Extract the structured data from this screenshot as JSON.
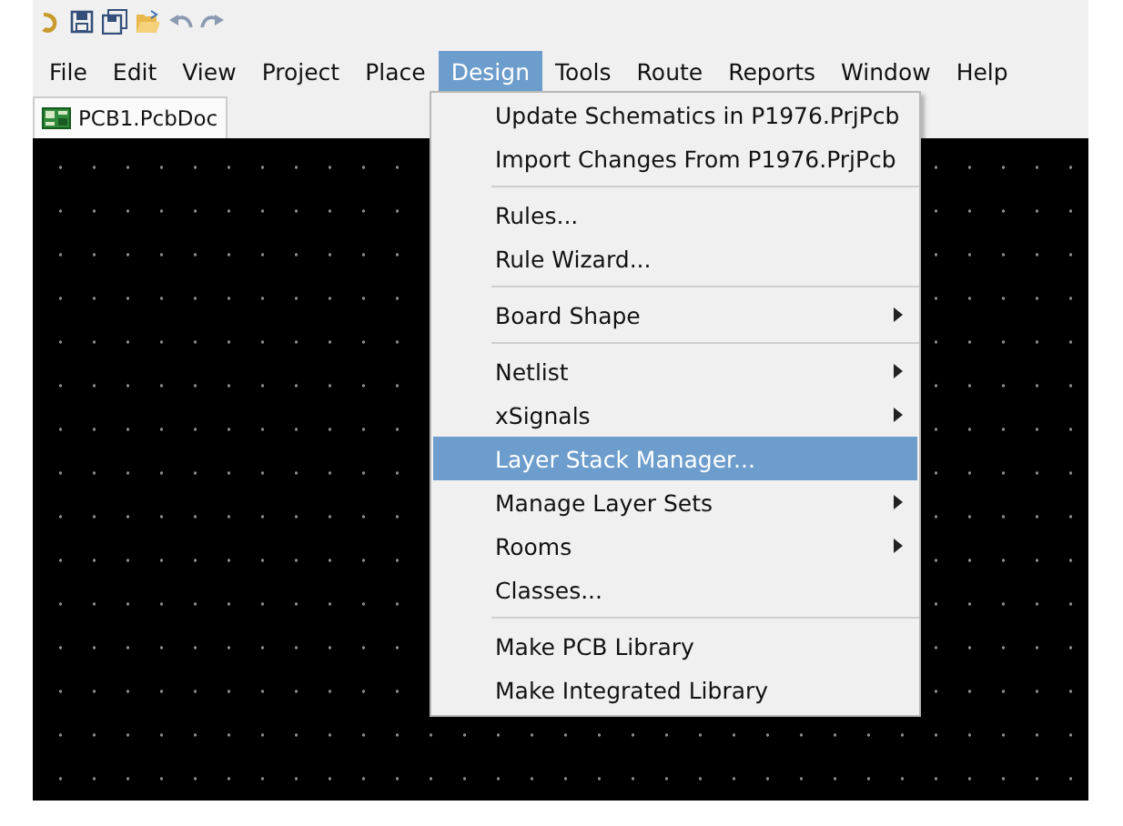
{
  "toolbar": [
    {
      "kind": "logo"
    },
    {
      "kind": "save"
    },
    {
      "kind": "save-all"
    },
    {
      "kind": "open"
    },
    {
      "kind": "undo"
    },
    {
      "kind": "redo"
    }
  ],
  "menubar": [
    {
      "label": "File",
      "selected": false
    },
    {
      "label": "Edit",
      "selected": false
    },
    {
      "label": "View",
      "selected": false
    },
    {
      "label": "Project",
      "selected": false
    },
    {
      "label": "Place",
      "selected": false
    },
    {
      "label": "Design",
      "selected": true
    },
    {
      "label": "Tools",
      "selected": false
    },
    {
      "label": "Route",
      "selected": false
    },
    {
      "label": "Reports",
      "selected": false
    },
    {
      "label": "Window",
      "selected": false
    },
    {
      "label": "Help",
      "selected": false
    }
  ],
  "tabs": [
    {
      "label": "PCB1.PcbDoc",
      "selected": true
    }
  ],
  "menu": {
    "items": [
      {
        "kind": "command",
        "label": "Update Schematics in P1976.PrjPcb",
        "selected": false
      },
      {
        "kind": "command",
        "label": "Import Changes From P1976.PrjPcb",
        "selected": false
      },
      {
        "kind": "separator"
      },
      {
        "kind": "command",
        "label": "Rules...",
        "selected": false
      },
      {
        "kind": "command",
        "label": "Rule Wizard...",
        "selected": false
      },
      {
        "kind": "separator"
      },
      {
        "kind": "submenu",
        "label": "Board Shape",
        "selected": false
      },
      {
        "kind": "separator"
      },
      {
        "kind": "submenu",
        "label": "Netlist",
        "selected": false
      },
      {
        "kind": "submenu",
        "label": "xSignals",
        "selected": false
      },
      {
        "kind": "command",
        "label": "Layer Stack Manager...",
        "selected": true
      },
      {
        "kind": "submenu",
        "label": "Manage Layer Sets",
        "selected": false
      },
      {
        "kind": "submenu",
        "label": "Rooms",
        "selected": false
      },
      {
        "kind": "command",
        "label": "Classes...",
        "selected": false
      },
      {
        "kind": "separator"
      },
      {
        "kind": "command",
        "label": "Make PCB Library",
        "selected": false
      },
      {
        "kind": "command",
        "label": "Make Integrated Library",
        "selected": false
      }
    ]
  }
}
